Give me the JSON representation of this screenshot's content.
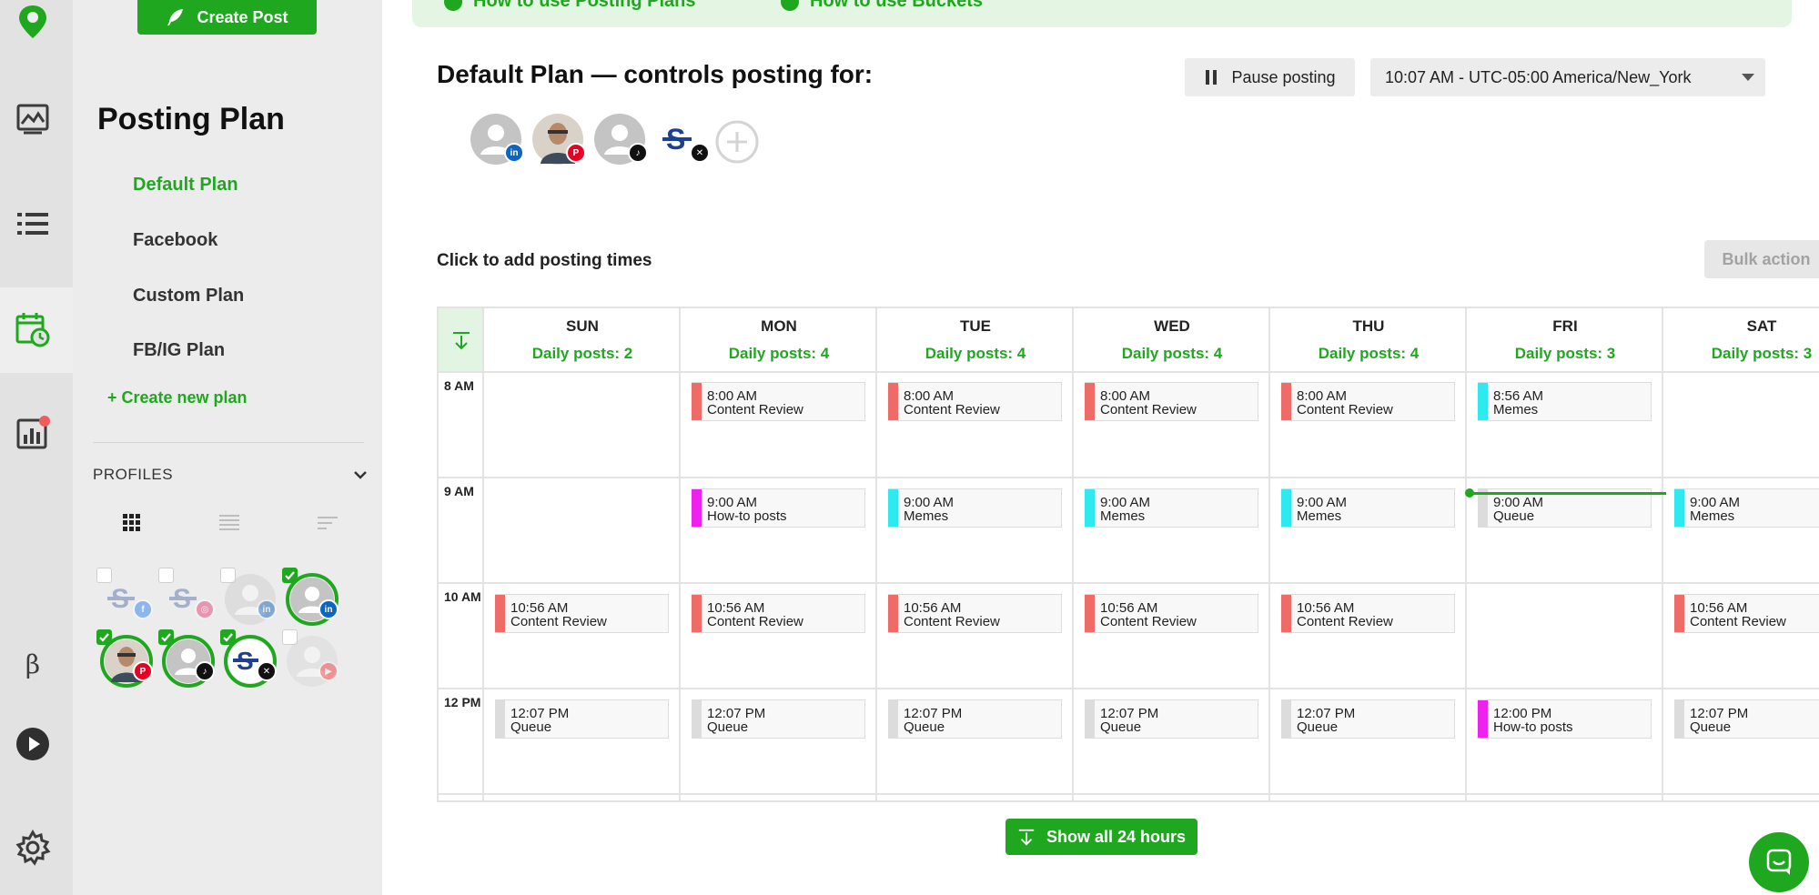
{
  "rail": {
    "icons": [
      "logo-pin-icon",
      "media-library-icon",
      "list-icon",
      "calendar-clock-icon",
      "analytics-icon",
      "beta-icon",
      "play-icon",
      "gear-icon"
    ],
    "beta_label": "β",
    "notification_color": "#f25b5b"
  },
  "sidebar": {
    "create_post_label": "Create Post",
    "title": "Posting Plan",
    "plans": [
      "Default Plan",
      "Facebook",
      "Custom Plan",
      "FB/IG Plan"
    ],
    "create_plan_label": "+ Create new plan",
    "profiles_label": "PROFILES",
    "profiles": [
      {
        "network": "facebook",
        "selected": false,
        "type": "logo"
      },
      {
        "network": "instagram",
        "selected": false,
        "type": "logo"
      },
      {
        "network": "linkedin",
        "selected": false,
        "type": "avatar"
      },
      {
        "network": "linkedin",
        "selected": true,
        "type": "avatar"
      },
      {
        "network": "pinterest",
        "selected": true,
        "type": "photo"
      },
      {
        "network": "tiktok",
        "selected": true,
        "type": "avatar"
      },
      {
        "network": "x",
        "selected": true,
        "type": "logo"
      },
      {
        "network": "youtube",
        "selected": false,
        "type": "avatar"
      }
    ]
  },
  "main": {
    "info_links": [
      "How to use Posting Plans",
      "How to use Buckets"
    ],
    "heading": "Default Plan — controls posting for:",
    "pause_label": "Pause posting",
    "timezone": "10:07 AM - UTC-05:00 America/New_York",
    "accounts": [
      "linkedin",
      "pinterest",
      "tiktok",
      "x"
    ],
    "hint": "Click to add posting times",
    "bulk_label": "Bulk action",
    "show_all_label": "Show all 24 hours"
  },
  "calendar": {
    "days": [
      {
        "name": "SUN",
        "daily": "Daily posts: 2"
      },
      {
        "name": "MON",
        "daily": "Daily posts: 4"
      },
      {
        "name": "TUE",
        "daily": "Daily posts: 4"
      },
      {
        "name": "WED",
        "daily": "Daily posts: 4"
      },
      {
        "name": "THU",
        "daily": "Daily posts: 4"
      },
      {
        "name": "FRI",
        "daily": "Daily posts: 3"
      },
      {
        "name": "SAT",
        "daily": "Daily posts: 3"
      }
    ],
    "hours": [
      "8 AM",
      "9 AM",
      "10 AM",
      "12 PM"
    ],
    "bucket_colors": {
      "Content Review": "#ee6b68",
      "Memes": "#2ee9ef",
      "How-to posts": "#ee22ee",
      "Queue": "#dcdcdc"
    },
    "slots": [
      {
        "day": 1,
        "row": 0,
        "time": "8:00 AM",
        "label": "Content Review"
      },
      {
        "day": 2,
        "row": 0,
        "time": "8:00 AM",
        "label": "Content Review"
      },
      {
        "day": 3,
        "row": 0,
        "time": "8:00 AM",
        "label": "Content Review"
      },
      {
        "day": 4,
        "row": 0,
        "time": "8:00 AM",
        "label": "Content Review"
      },
      {
        "day": 5,
        "row": 0,
        "time": "8:56 AM",
        "label": "Memes"
      },
      {
        "day": 1,
        "row": 1,
        "time": "9:00 AM",
        "label": "How-to posts"
      },
      {
        "day": 2,
        "row": 1,
        "time": "9:00 AM",
        "label": "Memes"
      },
      {
        "day": 3,
        "row": 1,
        "time": "9:00 AM",
        "label": "Memes"
      },
      {
        "day": 4,
        "row": 1,
        "time": "9:00 AM",
        "label": "Memes"
      },
      {
        "day": 5,
        "row": 1,
        "time": "9:00 AM",
        "label": "Queue"
      },
      {
        "day": 6,
        "row": 1,
        "time": "9:00 AM",
        "label": "Memes"
      },
      {
        "day": 0,
        "row": 2,
        "time": "10:56 AM",
        "label": "Content Review"
      },
      {
        "day": 1,
        "row": 2,
        "time": "10:56 AM",
        "label": "Content Review"
      },
      {
        "day": 2,
        "row": 2,
        "time": "10:56 AM",
        "label": "Content Review"
      },
      {
        "day": 3,
        "row": 2,
        "time": "10:56 AM",
        "label": "Content Review"
      },
      {
        "day": 4,
        "row": 2,
        "time": "10:56 AM",
        "label": "Content Review"
      },
      {
        "day": 6,
        "row": 2,
        "time": "10:56 AM",
        "label": "Content Review"
      },
      {
        "day": 0,
        "row": 3,
        "time": "12:07 PM",
        "label": "Queue"
      },
      {
        "day": 1,
        "row": 3,
        "time": "12:07 PM",
        "label": "Queue"
      },
      {
        "day": 2,
        "row": 3,
        "time": "12:07 PM",
        "label": "Queue"
      },
      {
        "day": 3,
        "row": 3,
        "time": "12:07 PM",
        "label": "Queue"
      },
      {
        "day": 4,
        "row": 3,
        "time": "12:07 PM",
        "label": "Queue"
      },
      {
        "day": 5,
        "row": 3,
        "time": "12:00 PM",
        "label": "How-to posts"
      },
      {
        "day": 6,
        "row": 3,
        "time": "12:07 PM",
        "label": "Queue"
      }
    ]
  },
  "colors": {
    "accent": "#1fa81f",
    "accent_light": "#e4f5e4",
    "linkedin": "#0a66c2",
    "pinterest": "#e60023",
    "tiktok": "#111111",
    "x": "#111111",
    "facebook": "#1877f2",
    "instagram": "#e1306c",
    "youtube": "#ff0000",
    "brand_navy": "#1f3f8f"
  }
}
